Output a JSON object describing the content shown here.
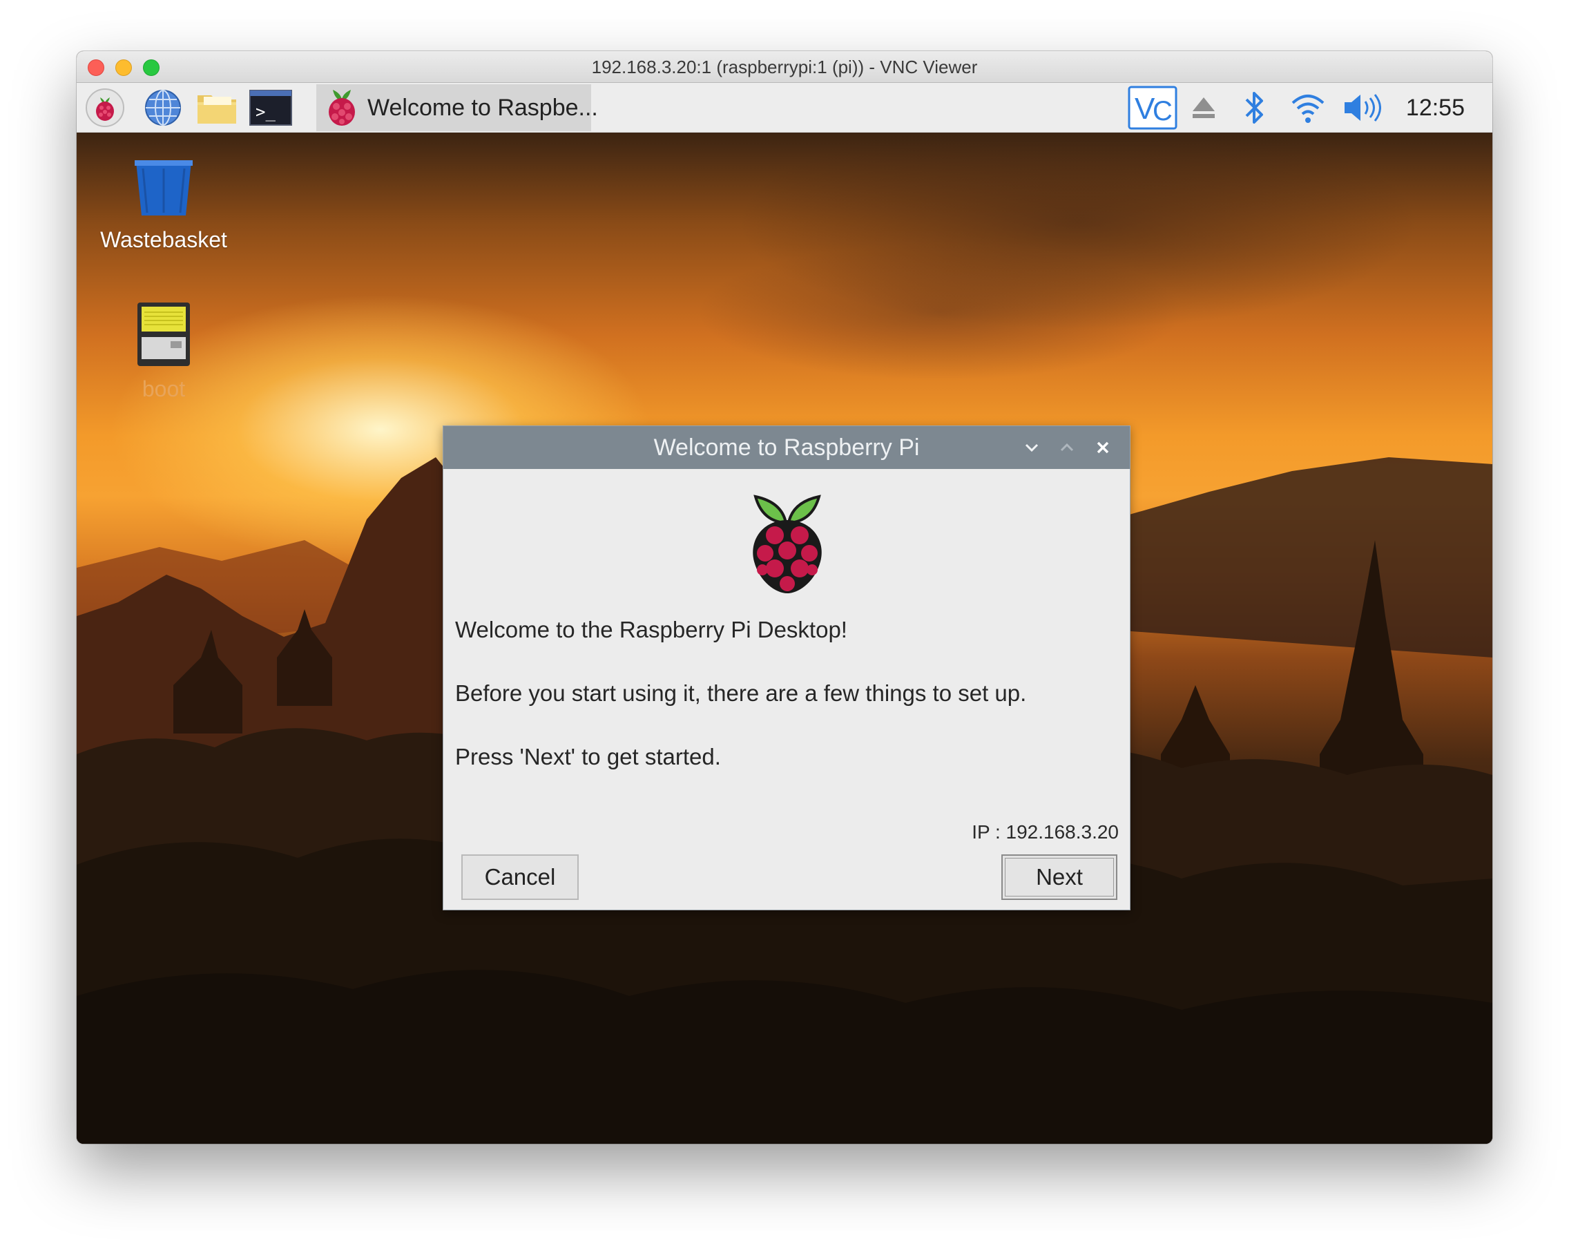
{
  "mac_window": {
    "title": "192.168.3.20:1 (raspberrypi:1 (pi)) - VNC Viewer"
  },
  "taskbar": {
    "launchers": [
      {
        "name": "raspberry-menu-icon"
      },
      {
        "name": "web-browser-icon"
      },
      {
        "name": "file-manager-icon"
      },
      {
        "name": "terminal-icon"
      }
    ],
    "active_task_label": "Welcome to Raspbe...",
    "tray": [
      "vnc-icon",
      "eject-icon",
      "bluetooth-icon",
      "wifi-icon",
      "volume-icon"
    ],
    "clock": "12:55"
  },
  "desktop": {
    "icons": [
      {
        "label": "Wastebasket",
        "icon": "wastebasket-icon"
      },
      {
        "label": "boot",
        "icon": "sd-card-drive-icon"
      }
    ]
  },
  "dialog": {
    "title": "Welcome to Raspberry Pi",
    "line1": "Welcome to the Raspberry Pi Desktop!",
    "line2": "Before you start using it, there are a few things to set up.",
    "line3": "Press 'Next' to get started.",
    "ip": "IP : 192.168.3.20",
    "cancel_label": "Cancel",
    "next_label": "Next"
  },
  "colors": {
    "dialog_header": "#7d8891",
    "accent_blue": "#2f7fe0"
  }
}
